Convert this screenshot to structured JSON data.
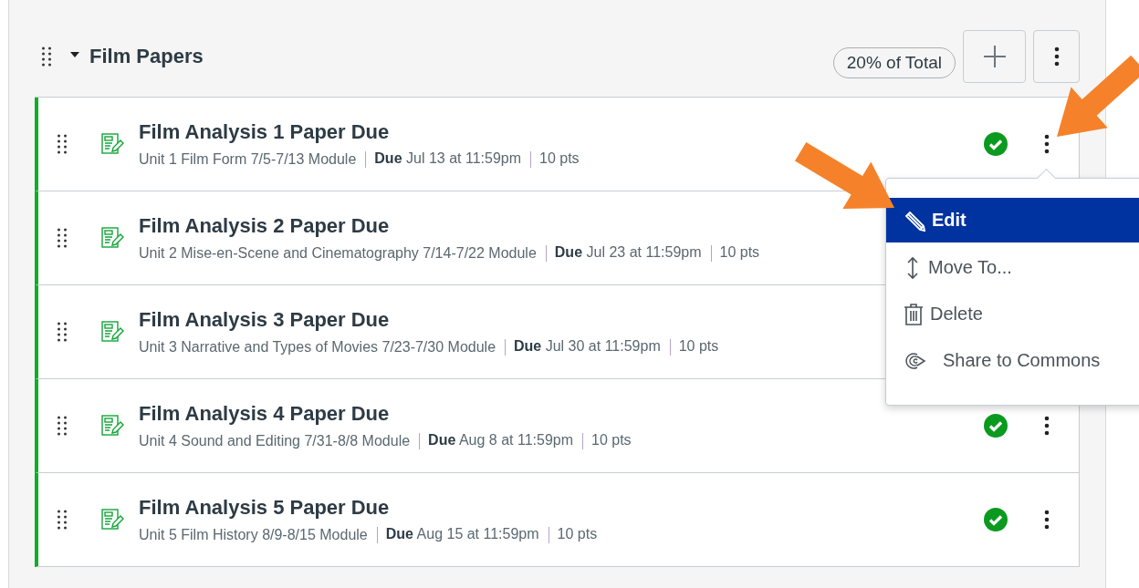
{
  "group": {
    "title": "Film Papers",
    "expanded": true,
    "weight": "20% of Total"
  },
  "items": [
    {
      "title": "Film Analysis 1 Paper Due",
      "module": "Unit 1 Film Form 7/5-7/13 Module",
      "due": "**Due** Jul 13 at 11:59pm",
      "points": "10 pts",
      "published": true
    },
    {
      "title": "Film Analysis 2 Paper Due",
      "module": "Unit 2 Mise-en-Scene and Cinematography 7/14-7/22 Module",
      "due": "**Due** Jul 23 at 11:59pm",
      "points": "10 pts"
    },
    {
      "title": "Film Analysis 3 Paper Due",
      "module": "Unit 3 Narrative and Types of Movies 7/23-7/30 Module",
      "due": "**Due** Jul 30 at 11:59pm",
      "points": "10 pts"
    },
    {
      "title": "Film Analysis 4 Paper Due",
      "module": "Unit 4 Sound and Editing 7/31-8/8 Module",
      "due": "**Due** Aug 8 at 11:59pm",
      "points": "10 pts",
      "published": true
    },
    {
      "title": "Film Analysis 5 Paper Due",
      "module": "Unit 5 Film History 8/9-8/15 Module",
      "due": "**Due** Aug 15 at 11:59pm",
      "points": "10 pts",
      "published": true
    }
  ],
  "menu": [
    {
      "label": "Edit",
      "kind": "edit",
      "selected": true
    },
    {
      "label": "Move To...",
      "kind": "move",
      "selected": false
    },
    {
      "label": "Delete",
      "kind": "delete",
      "selected": false
    },
    {
      "label": "Share to Commons",
      "kind": "share",
      "selected": false
    }
  ],
  "arrows": [
    {
      "kind": "arrow"
    },
    {
      "kind": "arrow"
    }
  ]
}
